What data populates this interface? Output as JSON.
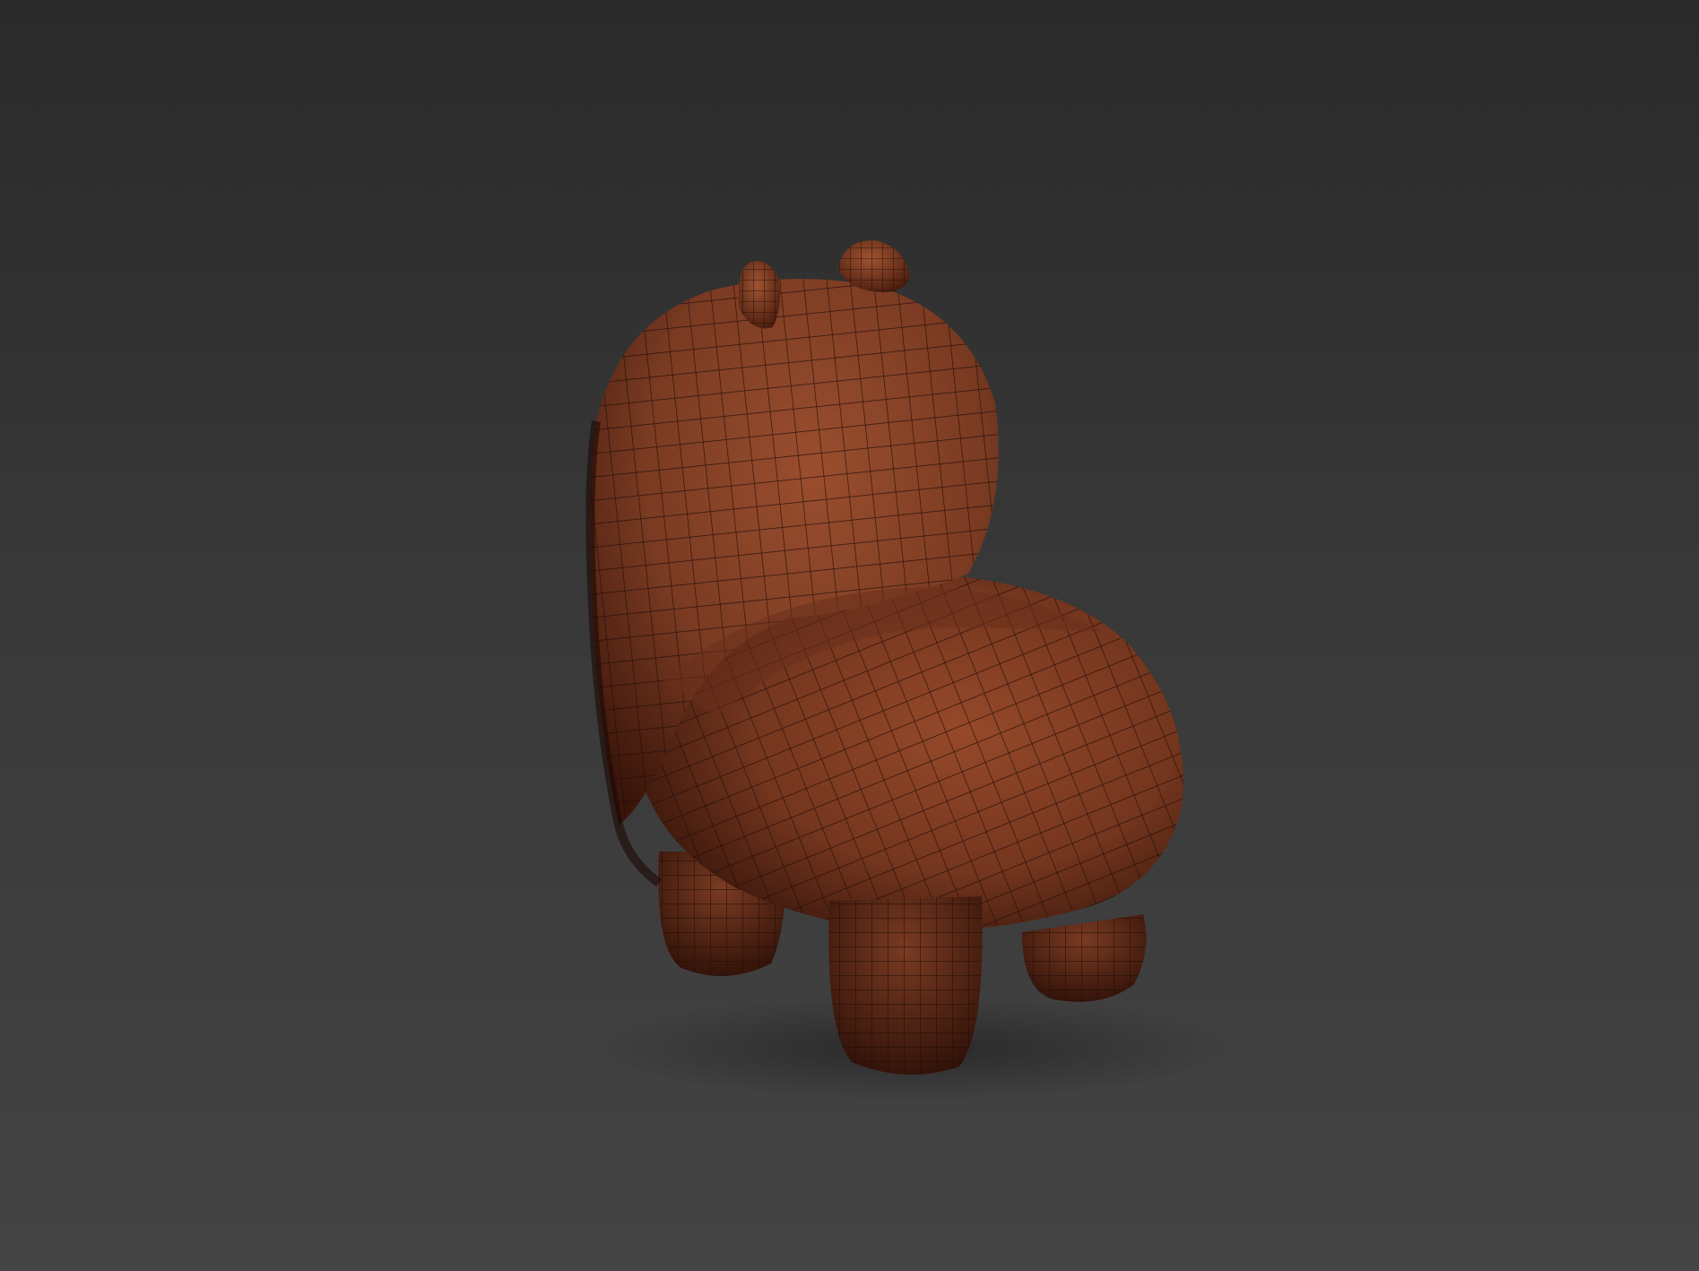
{
  "viewport": {
    "background_top": "#2a2a2a",
    "background_bottom": "#444444",
    "shading_mode": "smooth-with-wireframe-edges"
  },
  "model": {
    "object": "creature-mesh",
    "surface_color": "#7a3b22",
    "highlight_color": "#9a4e2e",
    "shadow_color": "#3a150a",
    "wire_color": "#1f0c08"
  }
}
